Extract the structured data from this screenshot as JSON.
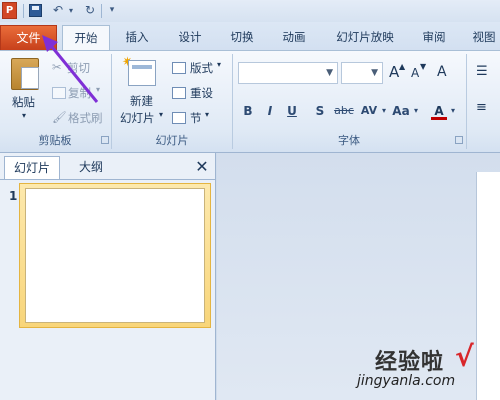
{
  "quick_access": {
    "app_icon_label": "P",
    "icons": [
      "save-icon",
      "undo-icon",
      "redo-icon",
      "customize-icon"
    ]
  },
  "tabs": {
    "file": "文件",
    "home": "开始",
    "insert": "插入",
    "design": "设计",
    "transitions": "切换",
    "animations": "动画",
    "slideshow": "幻灯片放映",
    "review": "审阅",
    "view": "视图"
  },
  "ribbon": {
    "clipboard": {
      "paste": "粘贴",
      "cut": "剪切",
      "copy": "复制",
      "format_painter": "格式刷",
      "group_label": "剪贴板"
    },
    "slides": {
      "new_slide_line1": "新建",
      "new_slide_line2": "幻灯片",
      "layout": "版式",
      "reset": "重设",
      "section": "节",
      "group_label": "幻灯片"
    },
    "font": {
      "font_name": "",
      "font_size": "",
      "grow": "A",
      "shrink": "A",
      "clear_format": "A",
      "bold": "B",
      "italic": "I",
      "underline": "U",
      "shadow": "S",
      "strikethrough": "abc",
      "spacing": "AV",
      "change_case": "Aa",
      "font_color": "A",
      "group_label": "字体"
    }
  },
  "panel": {
    "tab_slides": "幻灯片",
    "tab_outline": "大纲",
    "close": "✕",
    "slide_number": "1"
  },
  "watermark": {
    "text": "经验啦",
    "check": "√",
    "url": "jingyanla.com"
  },
  "colors": {
    "file_tab": "#d24f24",
    "accent": "#7f2fd6",
    "ribbon_bg": "#dfe9f5"
  }
}
